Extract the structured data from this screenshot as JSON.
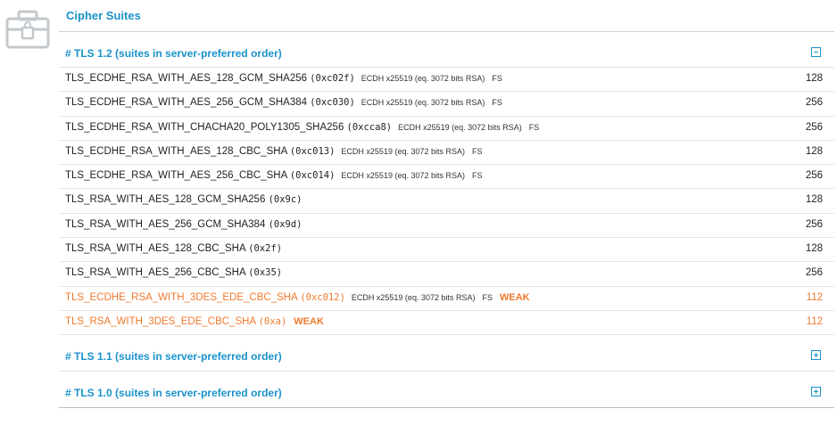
{
  "section_title": "Cipher Suites",
  "groups": [
    {
      "title": "# TLS 1.2 (suites in server-preferred order)",
      "expanded": true
    },
    {
      "title": "# TLS 1.1 (suites in server-preferred order)",
      "expanded": false
    },
    {
      "title": "# TLS 1.0 (suites in server-preferred order)",
      "expanded": false
    }
  ],
  "suites": [
    {
      "name": "TLS_ECDHE_RSA_WITH_AES_128_GCM_SHA256",
      "code": "(0xc02f)",
      "kx": "ECDH x25519 (eq. 3072 bits RSA)",
      "fs": "FS",
      "weak": "",
      "bits": "128"
    },
    {
      "name": "TLS_ECDHE_RSA_WITH_AES_256_GCM_SHA384",
      "code": "(0xc030)",
      "kx": "ECDH x25519 (eq. 3072 bits RSA)",
      "fs": "FS",
      "weak": "",
      "bits": "256"
    },
    {
      "name": "TLS_ECDHE_RSA_WITH_CHACHA20_POLY1305_SHA256",
      "code": "(0xcca8)",
      "kx": "ECDH x25519 (eq. 3072 bits RSA)",
      "fs": "FS",
      "weak": "",
      "bits": "256"
    },
    {
      "name": "TLS_ECDHE_RSA_WITH_AES_128_CBC_SHA",
      "code": "(0xc013)",
      "kx": "ECDH x25519 (eq. 3072 bits RSA)",
      "fs": "FS",
      "weak": "",
      "bits": "128"
    },
    {
      "name": "TLS_ECDHE_RSA_WITH_AES_256_CBC_SHA",
      "code": "(0xc014)",
      "kx": "ECDH x25519 (eq. 3072 bits RSA)",
      "fs": "FS",
      "weak": "",
      "bits": "256"
    },
    {
      "name": "TLS_RSA_WITH_AES_128_GCM_SHA256",
      "code": "(0x9c)",
      "kx": "",
      "fs": "",
      "weak": "",
      "bits": "128"
    },
    {
      "name": "TLS_RSA_WITH_AES_256_GCM_SHA384",
      "code": "(0x9d)",
      "kx": "",
      "fs": "",
      "weak": "",
      "bits": "256"
    },
    {
      "name": "TLS_RSA_WITH_AES_128_CBC_SHA",
      "code": "(0x2f)",
      "kx": "",
      "fs": "",
      "weak": "",
      "bits": "128"
    },
    {
      "name": "TLS_RSA_WITH_AES_256_CBC_SHA",
      "code": "(0x35)",
      "kx": "",
      "fs": "",
      "weak": "",
      "bits": "256"
    },
    {
      "name": "TLS_ECDHE_RSA_WITH_3DES_EDE_CBC_SHA",
      "code": "(0xc012)",
      "kx": "ECDH x25519 (eq. 3072 bits RSA)",
      "fs": "FS",
      "weak": "WEAK",
      "bits": "112"
    },
    {
      "name": "TLS_RSA_WITH_3DES_EDE_CBC_SHA",
      "code": "(0xa)",
      "kx": "",
      "fs": "",
      "weak": "WEAK",
      "bits": "112"
    }
  ],
  "icons": {
    "section": "lock-briefcase-icon",
    "collapse": "minus-box-icon",
    "expand": "plus-box-icon"
  },
  "colors": {
    "accent": "#1a92cb",
    "weak": "#f07a2e"
  }
}
